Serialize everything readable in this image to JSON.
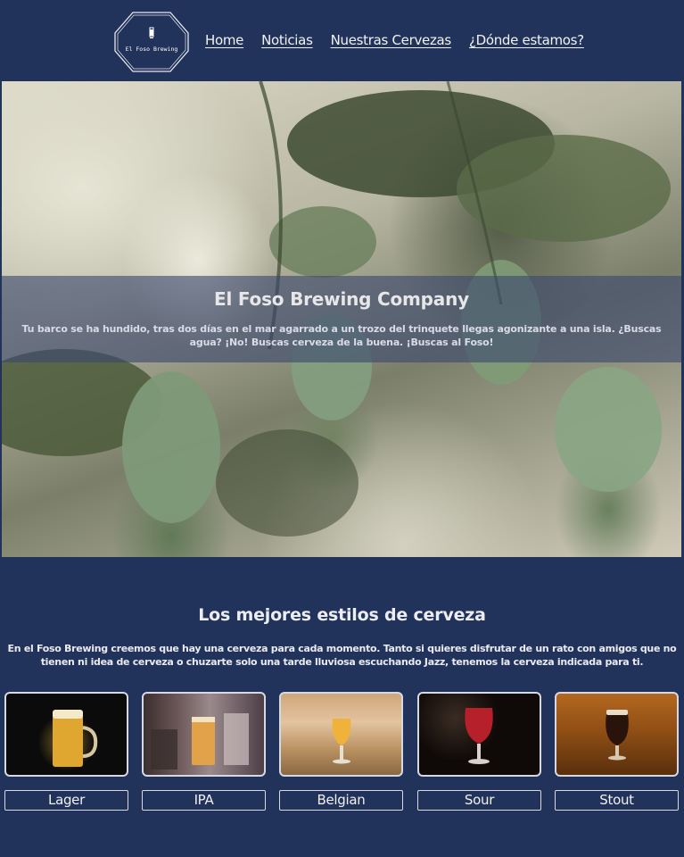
{
  "logo": {
    "text": "El Foso Brewing"
  },
  "nav": {
    "links": [
      "Home",
      "Noticias",
      "Nuestras Cervezas",
      "¿Dónde estamos?"
    ]
  },
  "hero": {
    "title": "El Foso Brewing Company",
    "text": "Tu barco se ha hundido, tras dos días en el mar agarrado a un trozo del trinquete llegas agonizante a una isla. ¿Buscas agua? ¡No! Buscas cerveza de la buena. ¡Buscas al Foso!"
  },
  "styles": {
    "title": "Los mejores estilos de cerveza",
    "text": "En el Foso Brewing creemos que hay una cerveza para cada momento. Tanto si quieres disfrutar de un rato con amigos que no tienen ni idea de cerveza o chuzarte solo una tarde lluviosa escuchando Jazz, tenemos la cerveza indicada para ti.",
    "cards": [
      {
        "label": "Lager",
        "image": "lager-beer-photo"
      },
      {
        "label": "IPA",
        "image": "ipa-beer-photo"
      },
      {
        "label": "Belgian",
        "image": "belgian-beer-photo"
      },
      {
        "label": "Sour",
        "image": "sour-beer-photo"
      },
      {
        "label": "Stout",
        "image": "stout-beer-photo"
      }
    ]
  },
  "colors": {
    "background": "#22335b",
    "band": "#3c486e"
  }
}
